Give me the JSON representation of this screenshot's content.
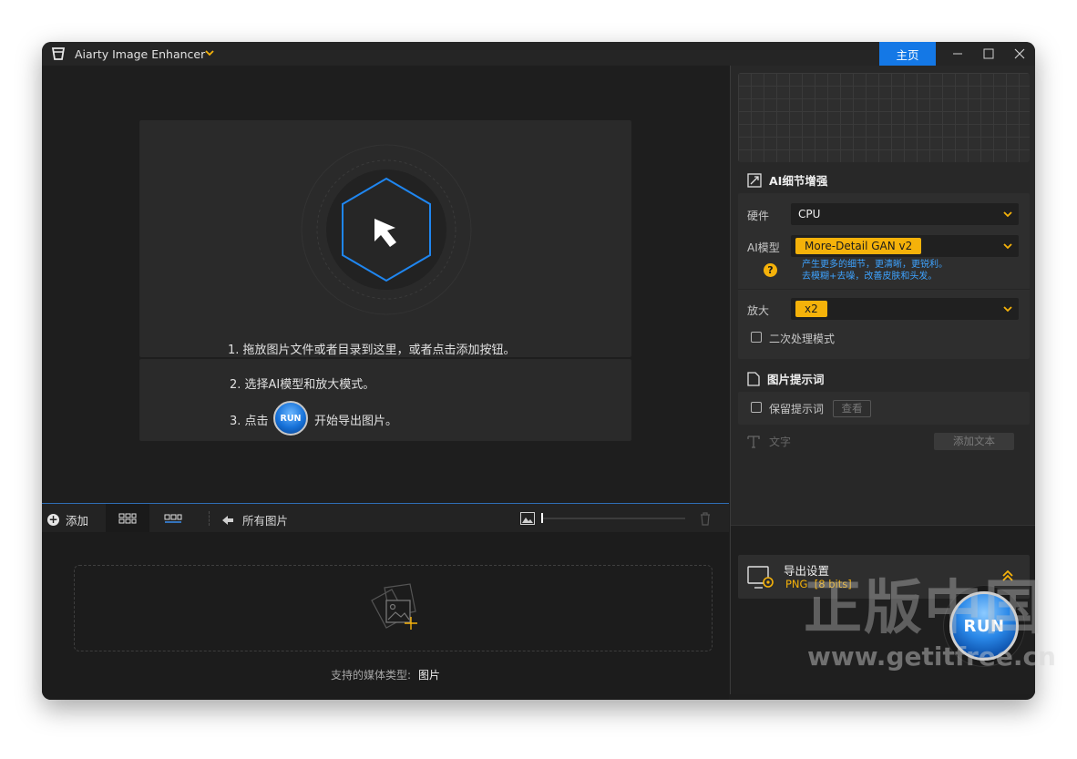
{
  "window": {
    "title": "Aiarty Image Enhancer",
    "home_label": "主页"
  },
  "drop_panel": {
    "step1": "1. 拖放图片文件或者目录到这里，或者点击添加按钮。",
    "step2": "2. 选择AI模型和放大模式。",
    "step3_prefix": "3. 点击",
    "step3_run": "RUN",
    "step3_suffix": "开始导出图片。"
  },
  "toolbar": {
    "add_label": "添加",
    "all_images_label": "所有图片"
  },
  "import": {
    "support_label": "支持的媒体类型:",
    "support_value": "图片"
  },
  "enhance": {
    "section_title": "AI细节增强",
    "hardware_label": "硬件",
    "hardware_value": "CPU",
    "model_label": "AI模型",
    "model_value": "More-Detail GAN v2",
    "model_desc_line1": "产生更多的细节，更清晰，更锐利。",
    "model_desc_line2": "去模糊+去噪，改善皮肤和头发。",
    "scale_label": "放大",
    "scale_value": "x2",
    "secondary_label": "二次处理模式"
  },
  "prompt": {
    "section_title": "图片提示词",
    "keep_label": "保留提示词",
    "view_label": "查看",
    "text_label": "文字",
    "add_text_label": "添加文本"
  },
  "export": {
    "title": "导出设置",
    "format": "PNG",
    "bits": "[8 bits]",
    "run_label": "RUN"
  },
  "watermark": {
    "big_text": "正版中国",
    "url_text": "www.getitfree.cn"
  },
  "colors": {
    "accent_blue": "#1478e6",
    "accent_yellow": "#f5b20a",
    "desc_blue": "#3ea3ff"
  }
}
